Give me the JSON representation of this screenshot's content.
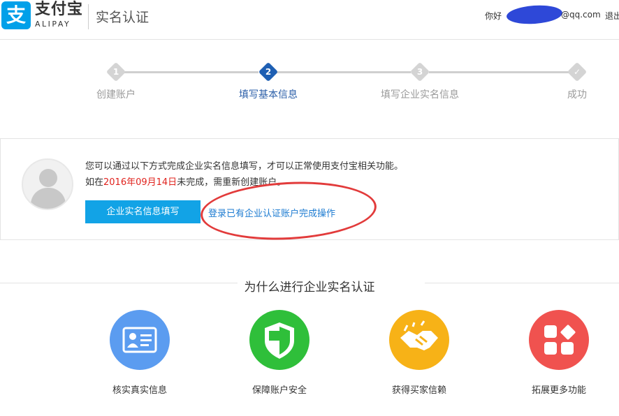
{
  "header": {
    "logo_mark": "支",
    "logo_cn": "支付宝",
    "logo_en": "ALIPAY",
    "page_title": "实名认证",
    "greeting": "你好",
    "user_domain": "@qq.com",
    "logout": "退出"
  },
  "steps": [
    {
      "num": "1",
      "label": "创建账户",
      "state": "done"
    },
    {
      "num": "2",
      "label": "填写基本信息",
      "state": "active"
    },
    {
      "num": "3",
      "label": "填写企业实名信息",
      "state": "pending"
    },
    {
      "num": "✓",
      "label": "成功",
      "state": "pending"
    }
  ],
  "info": {
    "line1": "您可以通过以下方式完成企业实名信息填写，才可以正常使用支付宝相关功能。",
    "line2_prefix": "如在",
    "line2_deadline": "2016年09月14日",
    "line2_suffix": "未完成，需重新创建账户。",
    "primary_button": "企业实名信息填写",
    "login_link": "登录已有企业认证账户完成操作"
  },
  "why": {
    "title": "为什么进行企业实名认证",
    "features": [
      {
        "label": "核实真实信息",
        "icon": "id-card-icon",
        "color": "#5b9cf0"
      },
      {
        "label": "保障账户安全",
        "icon": "shield-icon",
        "color": "#2fbf3a"
      },
      {
        "label": "获得买家信赖",
        "icon": "handshake-icon",
        "color": "#f7b217"
      },
      {
        "label": "拓展更多功能",
        "icon": "apps-icon",
        "color": "#f0524f"
      }
    ]
  },
  "colors": {
    "brand": "#00a0e9",
    "active_step": "#1e5fb3",
    "link": "#1c7bd1",
    "deadline": "#e0231e"
  }
}
